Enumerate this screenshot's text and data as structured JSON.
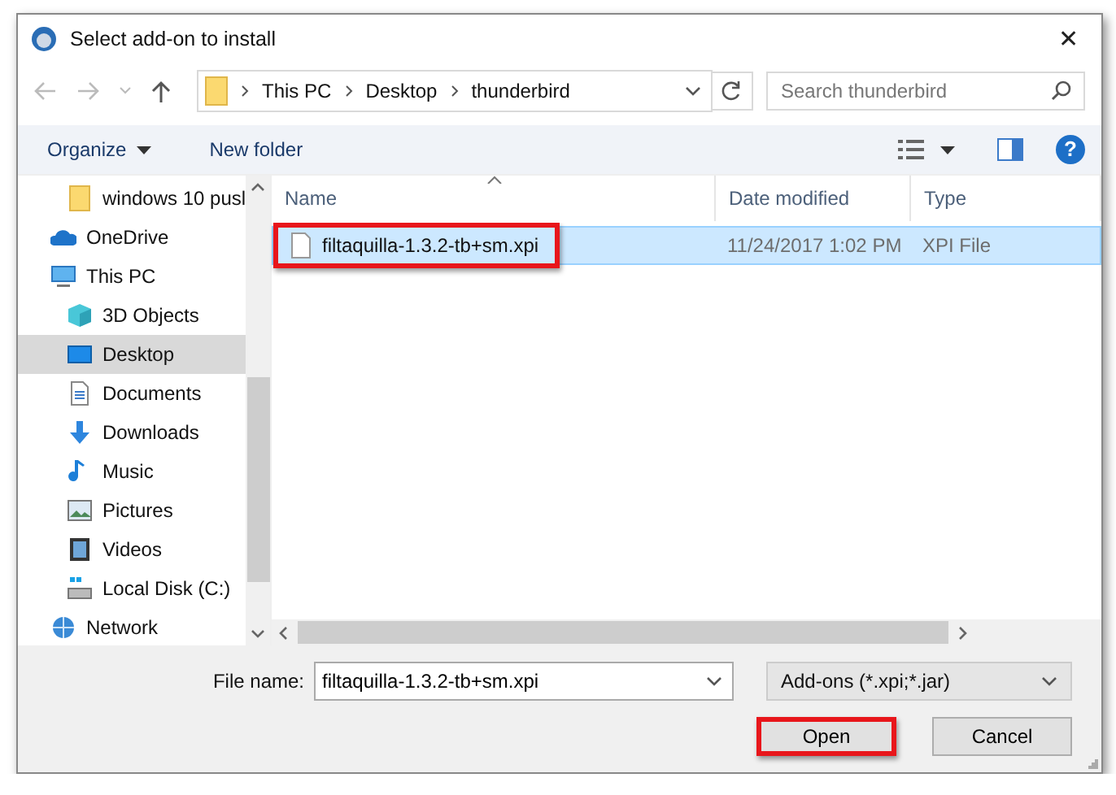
{
  "window": {
    "title": "Select add-on to install",
    "close": "✕"
  },
  "address": {
    "segments": [
      "This PC",
      "Desktop",
      "thunderbird"
    ]
  },
  "search": {
    "placeholder": "Search thunderbird"
  },
  "toolbar": {
    "organize": "Organize",
    "new_folder": "New folder",
    "help": "?"
  },
  "sidebar": {
    "items": [
      {
        "label": "windows 10 pusl",
        "kind": "folder",
        "indent": true,
        "selected": false
      },
      {
        "label": "OneDrive",
        "kind": "cloud",
        "indent": false,
        "selected": false
      },
      {
        "label": "This PC",
        "kind": "pc",
        "indent": false,
        "selected": false,
        "children": [
          {
            "label": "3D Objects",
            "kind": "cube",
            "selected": false
          },
          {
            "label": "Desktop",
            "kind": "desktop",
            "selected": true
          },
          {
            "label": "Documents",
            "kind": "document",
            "selected": false
          },
          {
            "label": "Downloads",
            "kind": "download",
            "selected": false
          },
          {
            "label": "Music",
            "kind": "music",
            "selected": false
          },
          {
            "label": "Pictures",
            "kind": "picture",
            "selected": false
          },
          {
            "label": "Videos",
            "kind": "video",
            "selected": false
          },
          {
            "label": "Local Disk (C:)",
            "kind": "disk",
            "selected": false
          }
        ]
      },
      {
        "label": "Network",
        "kind": "network",
        "indent": false,
        "selected": false
      }
    ]
  },
  "table": {
    "columns": [
      "Name",
      "Date modified",
      "Type"
    ],
    "rows": [
      {
        "name": "filtaquilla-1.3.2-tb+sm.xpi",
        "date": "11/24/2017 1:02 PM",
        "type": "XPI File",
        "selected": true,
        "highlighted": true
      }
    ]
  },
  "footer": {
    "file_name_label": "File name:",
    "file_name": "filtaquilla-1.3.2-tb+sm.xpi",
    "filter": "Add-ons (*.xpi;*.jar)",
    "buttons": [
      {
        "label": "Open",
        "highlighted": true
      },
      {
        "label": "Cancel",
        "highlighted": false
      }
    ]
  }
}
